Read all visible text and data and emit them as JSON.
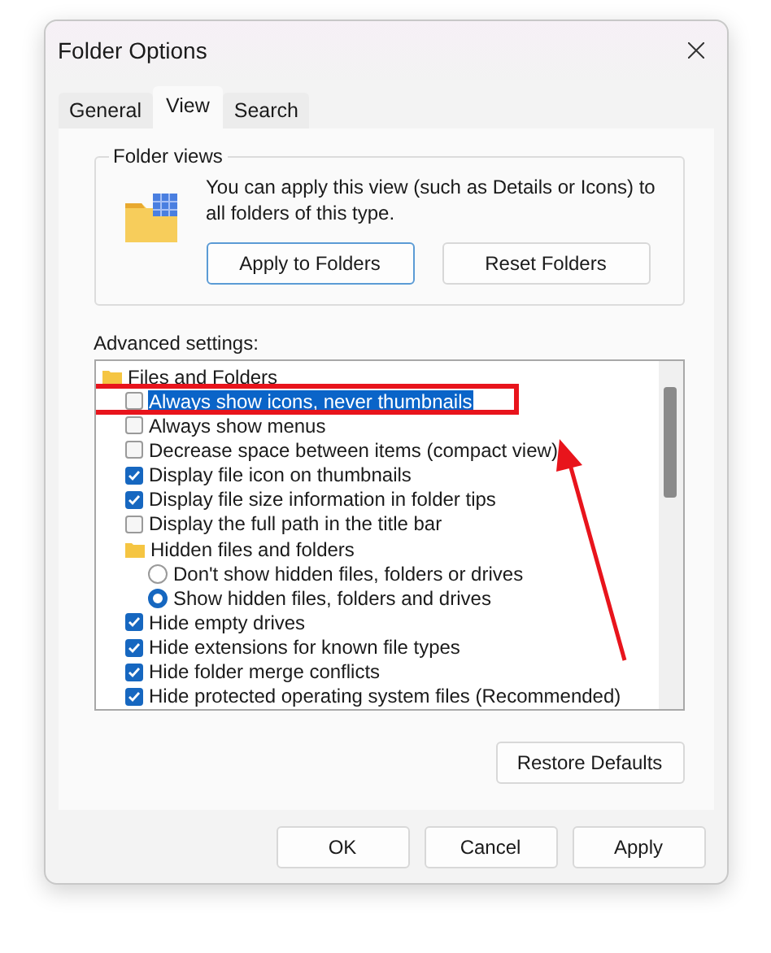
{
  "window": {
    "title": "Folder Options"
  },
  "tabs": [
    {
      "label": "General",
      "selected": false
    },
    {
      "label": "View",
      "selected": true
    },
    {
      "label": "Search",
      "selected": false
    }
  ],
  "folder_views": {
    "title": "Folder views",
    "description": "You can apply this view (such as Details or Icons) to all folders of this type.",
    "buttons": [
      {
        "label": "Apply to Folders",
        "focused": true
      },
      {
        "label": "Reset Folders",
        "focused": false
      }
    ]
  },
  "advanced_settings": {
    "label": "Advanced settings:",
    "items": [
      {
        "kind": "folder",
        "label": "Files and Folders",
        "children": [
          {
            "kind": "checkbox",
            "label": "Always show icons, never thumbnails",
            "checked": false,
            "selected": true,
            "annotated": true
          },
          {
            "kind": "checkbox",
            "label": "Always show menus",
            "checked": false,
            "selected": false,
            "annotated": false
          },
          {
            "kind": "checkbox",
            "label": "Decrease space between items (compact view)",
            "checked": false,
            "selected": false,
            "annotated": false
          },
          {
            "kind": "checkbox",
            "label": "Display file icon on thumbnails",
            "checked": true,
            "selected": false,
            "annotated": false
          },
          {
            "kind": "checkbox",
            "label": "Display file size information in folder tips",
            "checked": true,
            "selected": false,
            "annotated": false
          },
          {
            "kind": "checkbox",
            "label": "Display the full path in the title bar",
            "checked": false,
            "selected": false,
            "annotated": false
          },
          {
            "kind": "folder",
            "label": "Hidden files and folders",
            "children": [
              {
                "kind": "radio",
                "label": "Don't show hidden files, folders or drives",
                "checked": false,
                "selected": false,
                "annotated": false
              },
              {
                "kind": "radio",
                "label": "Show hidden files, folders and drives",
                "checked": true,
                "selected": false,
                "annotated": false
              }
            ]
          },
          {
            "kind": "checkbox",
            "label": "Hide empty drives",
            "checked": true,
            "selected": false,
            "annotated": false
          },
          {
            "kind": "checkbox",
            "label": "Hide extensions for known file types",
            "checked": true,
            "selected": false,
            "annotated": false
          },
          {
            "kind": "checkbox",
            "label": "Hide folder merge conflicts",
            "checked": true,
            "selected": false,
            "annotated": false
          },
          {
            "kind": "checkbox",
            "label": "Hide protected operating system files (Recommended)",
            "checked": true,
            "selected": false,
            "annotated": false
          }
        ]
      }
    ],
    "restore_button": "Restore Defaults"
  },
  "footer_buttons": [
    "OK",
    "Cancel",
    "Apply"
  ]
}
